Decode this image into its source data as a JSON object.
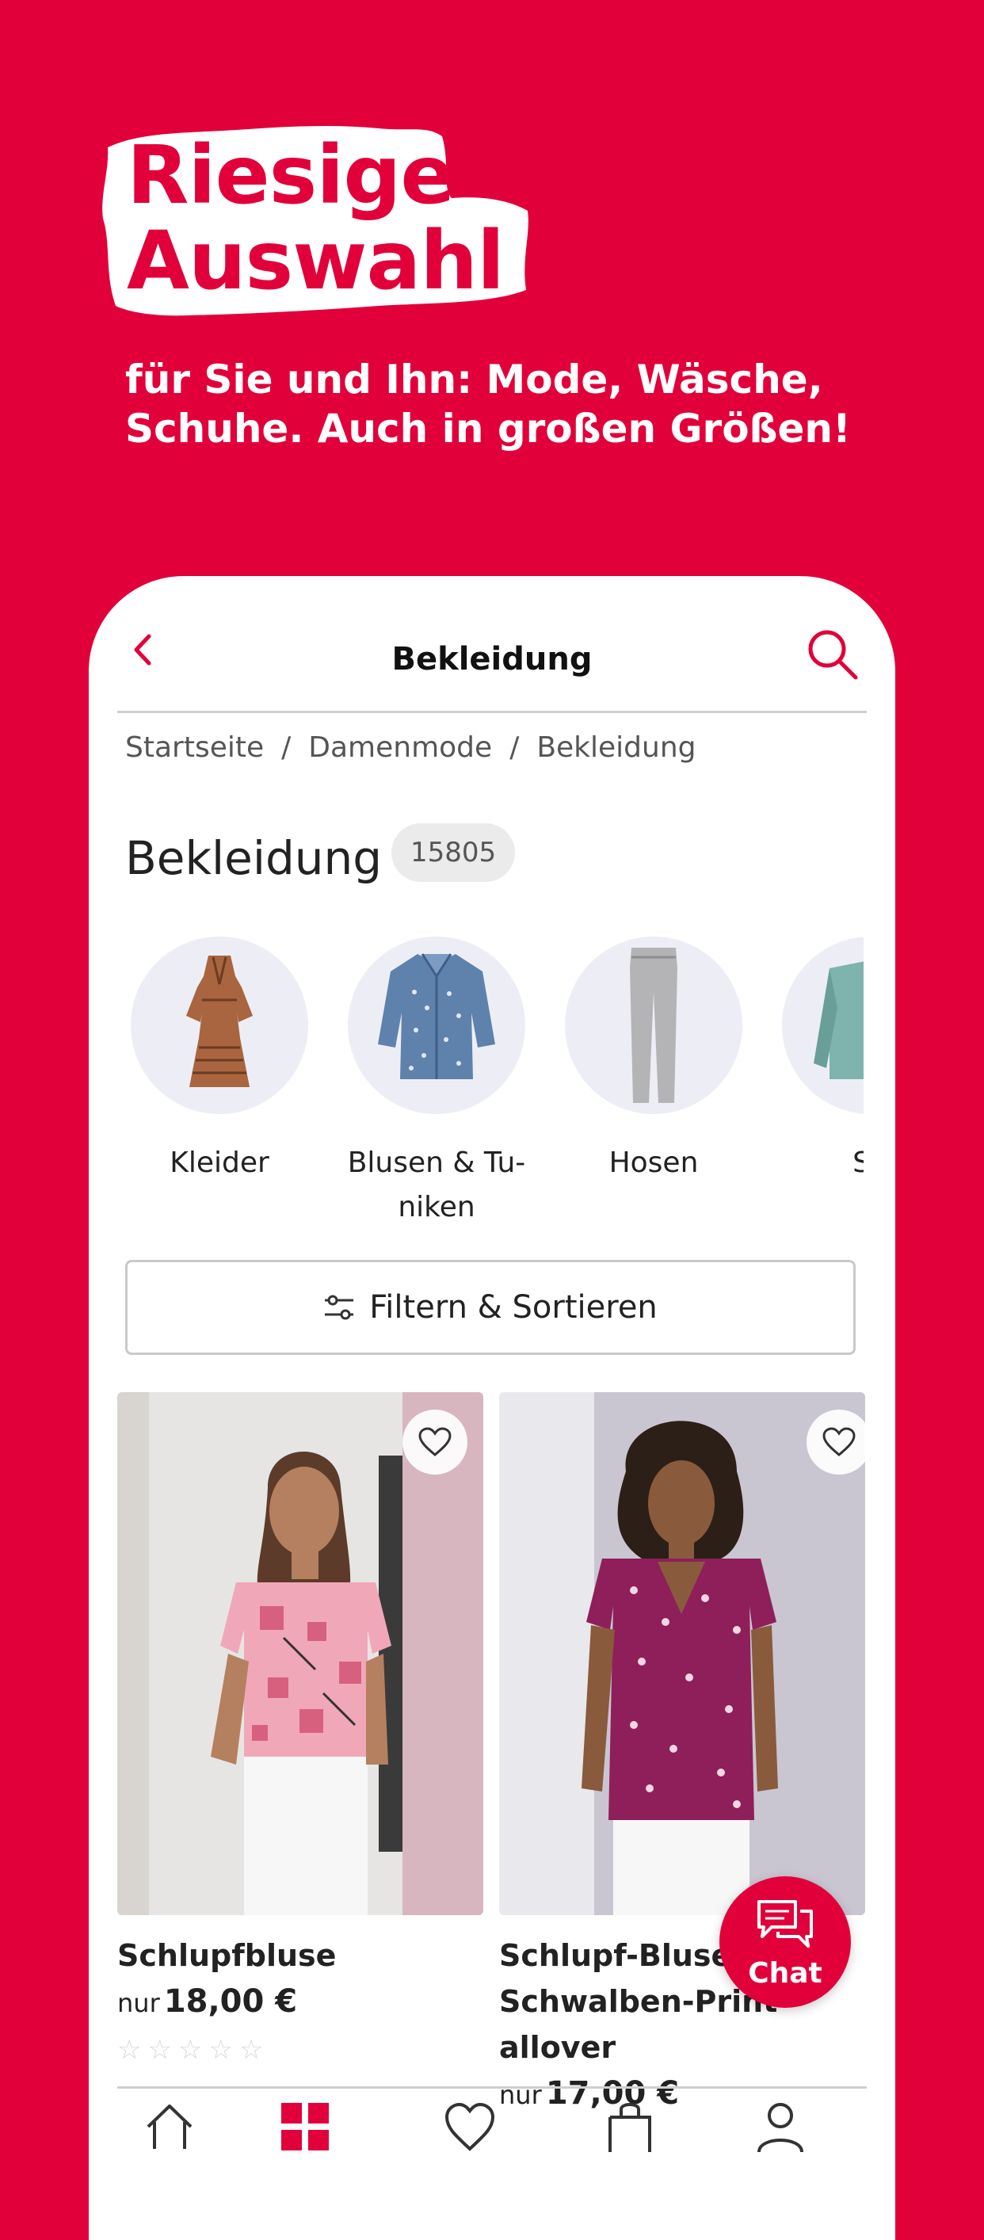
{
  "promo": {
    "headline_line1": "Riesige",
    "headline_line2": "Auswahl",
    "subline": "für Sie und Ihn: Mode, Wäsche, Schuhe. Auch in großen Größen!"
  },
  "header": {
    "title": "Bekleidung",
    "back_icon": "chevron-left-icon",
    "search_icon": "search-icon"
  },
  "breadcrumb": [
    "Startseite",
    "Damenmode",
    "Bekleidung"
  ],
  "breadcrumb_separator": "/",
  "page": {
    "title": "Bekleidung",
    "count": "15805"
  },
  "categories": [
    {
      "label": "Kleider"
    },
    {
      "label": "Blusen & Tu-\nniken"
    },
    {
      "label": "Hosen"
    },
    {
      "label": "Sh"
    }
  ],
  "filter": {
    "label": "Filtern & Sortieren",
    "icon": "sliders-icon"
  },
  "products": [
    {
      "name": "Schlupfbluse",
      "price_prefix": "nur",
      "price": "18,00 €",
      "rating": "☆☆☆☆☆"
    },
    {
      "name": "Schlupf-Bluse\nSchwalben-Print allover",
      "price_prefix": "nur",
      "price": "17,00 €"
    }
  ],
  "chat": {
    "label": "Chat",
    "icon": "chat-bubbles-icon"
  },
  "tabbar": {
    "icons": [
      "home-icon",
      "categories-icon",
      "heart-icon",
      "bag-icon",
      "account-icon"
    ]
  },
  "colors": {
    "brand": "#E2003A",
    "white": "#FFFFFF"
  }
}
